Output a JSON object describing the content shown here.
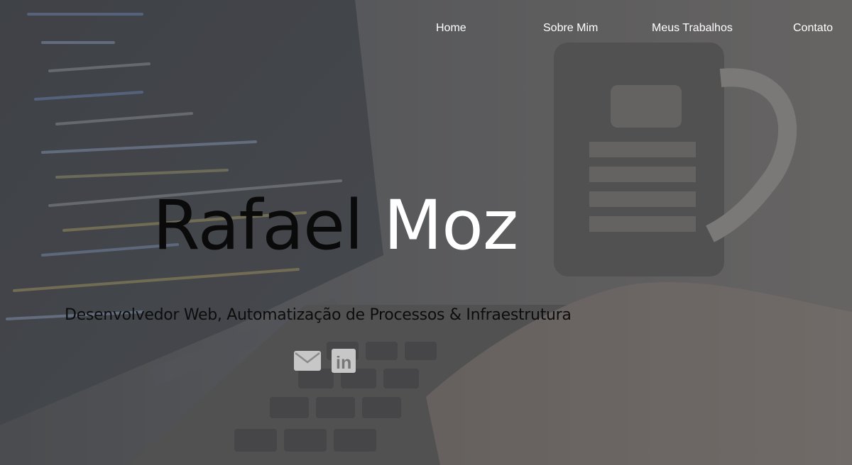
{
  "nav": {
    "items": [
      "Home",
      "Sobre Mim",
      "Meus Trabalhos",
      "Contato"
    ]
  },
  "hero": {
    "name_first": "Rafael",
    "name_last": "Moz",
    "subtitle": "Desenvolvedor Web, Automatização de Processos & Infraestrutura"
  },
  "social": {
    "icons": [
      "envelope-icon",
      "linkedin-icon"
    ],
    "linkedin_text": "in"
  },
  "colors": {
    "overlay": "#5f5f5f",
    "nav_text": "#ffffff",
    "name_first": "#0a0a0a",
    "name_last": "#ffffff",
    "icons": "#c7c7c7"
  }
}
